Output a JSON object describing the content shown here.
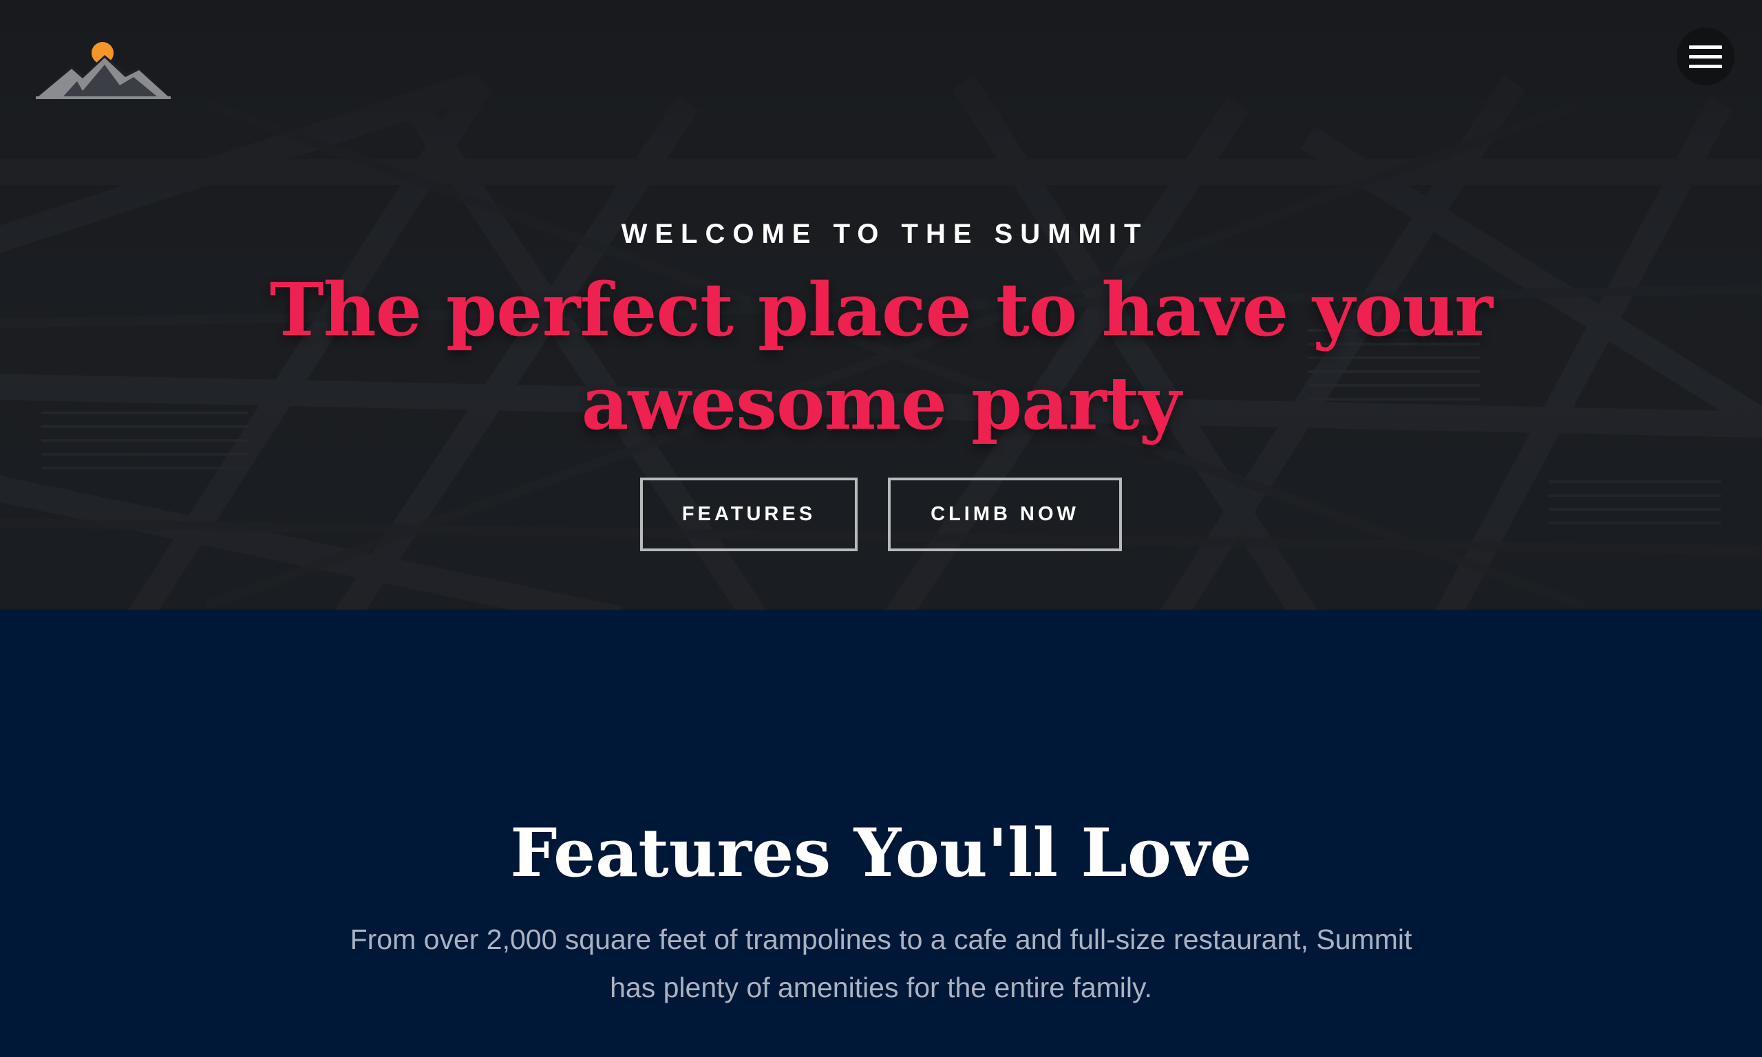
{
  "header": {
    "logo_icon": "mountain-sun-logo",
    "menu_icon": "hamburger-menu-icon"
  },
  "hero": {
    "eyebrow": "WELCOME TO THE SUMMIT",
    "headline": "The perfect place to have your awesome party",
    "buttons": {
      "features_label": "FEATURES",
      "climb_label": "CLIMB NOW"
    }
  },
  "features": {
    "title": "Features You'll Love",
    "description": "From over 2,000 square feet of trampolines to a cafe and full-size restaurant, Summit has plenty of amenities for the entire family."
  },
  "colors": {
    "accent": "#ee2150",
    "sun": "#f5962a",
    "hero_bg": "#1d2024",
    "section_bg": "#001838",
    "button_border": "#b8b9bb",
    "muted_text": "#aab3c2"
  }
}
